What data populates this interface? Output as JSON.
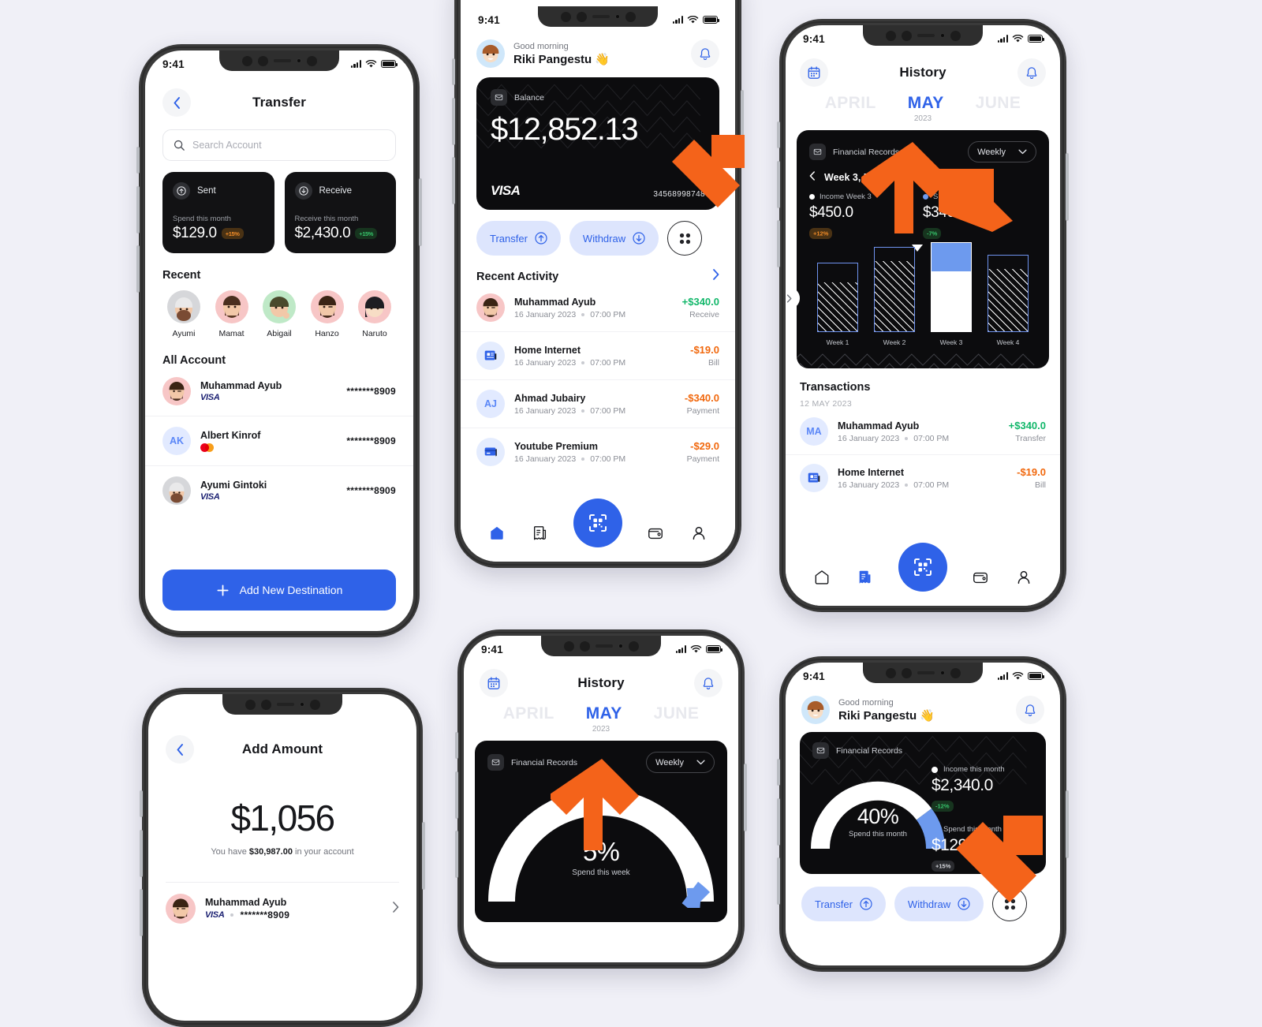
{
  "canvas": {
    "background": "#f0f0f7"
  },
  "status_bar": {
    "time": "9:41"
  },
  "colors": {
    "accent_blue": "#2f62e8",
    "dark_card": "#0c0c0e",
    "positive_green": "#12b76a",
    "negative_orange": "#f1680d",
    "arrow_orange": "#f4631a",
    "bar_blue": "#6d9aee"
  },
  "transfer_screen": {
    "title": "Transfer",
    "back_icon": "chevron-left-icon",
    "search": {
      "placeholder": "Search Account",
      "icon": "search-icon"
    },
    "summary_cards": [
      {
        "icon": "arrow-up-circle-icon",
        "label": "Sent",
        "caption": "Spend this month",
        "amount": "$129.0",
        "badge": "+15%",
        "badge_color": "orange"
      },
      {
        "icon": "arrow-down-circle-icon",
        "label": "Receive",
        "caption": "Receive this month",
        "amount": "$2,430.0",
        "badge": "+15%",
        "badge_color": "green"
      }
    ],
    "recent_title": "Recent",
    "recent": [
      {
        "name": "Ayumi",
        "bg": "#d6d7da"
      },
      {
        "name": "Mamat",
        "bg": "#f7c6c6"
      },
      {
        "name": "Abigail",
        "bg": "#bfe9c7"
      },
      {
        "name": "Hanzo",
        "bg": "#f7c6c6"
      },
      {
        "name": "Naruto",
        "bg": "#f7c6c6"
      }
    ],
    "all_account_title": "All Account",
    "accounts": [
      {
        "name": "Muhammad Ayub",
        "brand": "VISA",
        "number": "*******8909",
        "avatar_type": "photo",
        "bg": "#f7c6c6"
      },
      {
        "name": "Albert Kinrof",
        "brand": "mastercard",
        "number": "*******8909",
        "avatar_type": "initials",
        "initials": "AK"
      },
      {
        "name": "Ayumi Gintoki",
        "brand": "VISA",
        "number": "*******8909",
        "avatar_type": "photo",
        "bg": "#d6d7da"
      }
    ],
    "cta": {
      "label": "Add New Destination",
      "icon": "plus-icon"
    }
  },
  "home_screen": {
    "greeting_small": "Good morning",
    "greeting_name": "Riki Pangestu 👋",
    "bell_icon": "bell-icon",
    "card": {
      "icon": "wallet-icon",
      "label": "Balance",
      "amount": "$12,852.13",
      "brand": "VISA",
      "number": "34568998748"
    },
    "actions": [
      {
        "label": "Transfer",
        "icon": "arrow-up-circle-icon"
      },
      {
        "label": "Withdraw",
        "icon": "arrow-down-circle-icon"
      },
      {
        "label": "",
        "icon": "grid-icon"
      }
    ],
    "recent_activity_title": "Recent Activity",
    "recent_activity_chevron": "chevron-right-icon",
    "transactions": [
      {
        "name": "Muhammad Ayub",
        "date": "16 January 2023",
        "time": "07:00 PM",
        "amount": "+$340.0",
        "kind": "Receive",
        "sign": "p",
        "icon": "avatar-photo",
        "bg": "#f7c6c6"
      },
      {
        "name": "Home Internet",
        "date": "16 January 2023",
        "time": "07:00 PM",
        "amount": "-$19.0",
        "kind": "Bill",
        "sign": "n",
        "icon": "news-icon"
      },
      {
        "name": "Ahmad Jubairy",
        "date": "16 January 2023",
        "time": "07:00 PM",
        "amount": "-$340.0",
        "kind": "Payment",
        "sign": "n",
        "icon": "initials",
        "initials": "AJ"
      },
      {
        "name": "Youtube Premium",
        "date": "16 January 2023",
        "time": "07:00 PM",
        "amount": "-$29.0",
        "kind": "Payment",
        "sign": "n",
        "icon": "card-icon"
      }
    ],
    "tabbar": [
      {
        "name": "home",
        "icon": "home-icon",
        "active": true
      },
      {
        "name": "history",
        "icon": "receipt-icon",
        "active": false
      },
      {
        "name": "scan",
        "icon": "qr-scan-icon",
        "active": false
      },
      {
        "name": "wallet",
        "icon": "wallet-icon",
        "active": false
      },
      {
        "name": "profile",
        "icon": "user-icon",
        "active": false
      }
    ]
  },
  "history_screen": {
    "title": "History",
    "calendar_icon": "calendar-icon",
    "bell_icon": "bell-icon",
    "months": [
      "APRIL",
      "MAY",
      "JUNE"
    ],
    "active_month": "MAY",
    "year": "2023",
    "card": {
      "icon": "wallet-icon",
      "label": "Financial Records",
      "select_value": "Weekly",
      "select_icon": "chevron-down-icon",
      "period": "Week 3, MAY 2023",
      "prev_icon": "chevron-left-icon",
      "next_icon": "chevron-right-icon",
      "legends": [
        {
          "label": "Income Week 3",
          "value": "$450.0",
          "dot": "#ffffff",
          "badge": "+12%",
          "badge_color": "orange",
          "badge_icon": "arrow-down-right-icon"
        },
        {
          "label": "Spent Week 3",
          "value": "$340.0",
          "dot": "#6d9aee",
          "badge": "-7%",
          "badge_color": "green",
          "badge_icon": "arrow-down-left-icon"
        }
      ]
    },
    "transactions_title": "Transactions",
    "transactions_date": "12 MAY 2023",
    "transactions": [
      {
        "name": "Muhammad Ayub",
        "date": "16 January 2023",
        "time": "07:00 PM",
        "amount": "+$340.0",
        "kind": "Transfer",
        "sign": "p",
        "icon": "initials",
        "initials": "MA"
      },
      {
        "name": "Home Internet",
        "date": "16 January 2023",
        "time": "07:00 PM",
        "amount": "-$19.0",
        "kind": "Bill",
        "sign": "n",
        "icon": "news-icon"
      }
    ],
    "side_expand_icon": "chevron-right-icon"
  },
  "add_amount_screen": {
    "title": "Add Amount",
    "back_icon": "chevron-left-icon",
    "amount": "$1,056",
    "balance_prefix": "You have",
    "balance_value": "$30,987.00",
    "balance_suffix": "in your account",
    "account": {
      "name": "Muhammad Ayub",
      "brand": "VISA",
      "number": "*******8909",
      "chevron": "chevron-right-icon"
    }
  },
  "history_gauge_screen": {
    "title": "History",
    "calendar_icon": "calendar-icon",
    "bell_icon": "bell-icon",
    "months": [
      "APRIL",
      "MAY",
      "JUNE"
    ],
    "active_month": "MAY",
    "year": "2023",
    "card_label": "Financial Records",
    "card_icon": "wallet-icon",
    "select_value": "Weekly",
    "select_icon": "chevron-down-icon",
    "gauge_value": "5%",
    "gauge_caption": "Spend this week"
  },
  "home_gauge_screen": {
    "greeting_small": "Good morning",
    "greeting_name": "Riki Pangestu 👋",
    "bell_icon": "bell-icon",
    "card_label": "Financial Records",
    "card_icon": "wallet-icon",
    "gauge_value": "40%",
    "gauge_caption": "Spend this month",
    "legends": [
      {
        "label": "Income this month",
        "value": "$2,340.0",
        "dot": "#ffffff",
        "badge": "-12%",
        "badge_color": "green",
        "badge_icon": "arrow-down-left-icon"
      },
      {
        "label": "Spend this month",
        "value": "$129.0",
        "dot": "#6d9aee",
        "badge": "+15%",
        "badge_color": "gray",
        "badge_icon": "arrow-up-right-icon"
      }
    ],
    "actions": [
      {
        "label": "Transfer",
        "icon": "arrow-up-circle-icon"
      },
      {
        "label": "Withdraw",
        "icon": "arrow-down-circle-icon"
      },
      {
        "label": "",
        "icon": "grid-icon"
      }
    ]
  },
  "chart_data": {
    "type": "bar",
    "title": "Financial Records",
    "subtitle": "Week 3, MAY 2023",
    "categories": [
      "Week 1",
      "Week 2",
      "Week 3",
      "Week 4"
    ],
    "series": [
      {
        "name": "Income",
        "values": [
          78,
          96,
          100,
          86
        ]
      },
      {
        "name": "Spent",
        "values": [
          62,
          80,
          70,
          72
        ]
      }
    ],
    "highlight_index": 2,
    "ylabel": "",
    "xlabel": "",
    "legend": [
      "Income Week 3",
      "Spent Week 3"
    ],
    "legend_values": [
      "$450.0",
      "$340.0"
    ],
    "grid": false
  }
}
